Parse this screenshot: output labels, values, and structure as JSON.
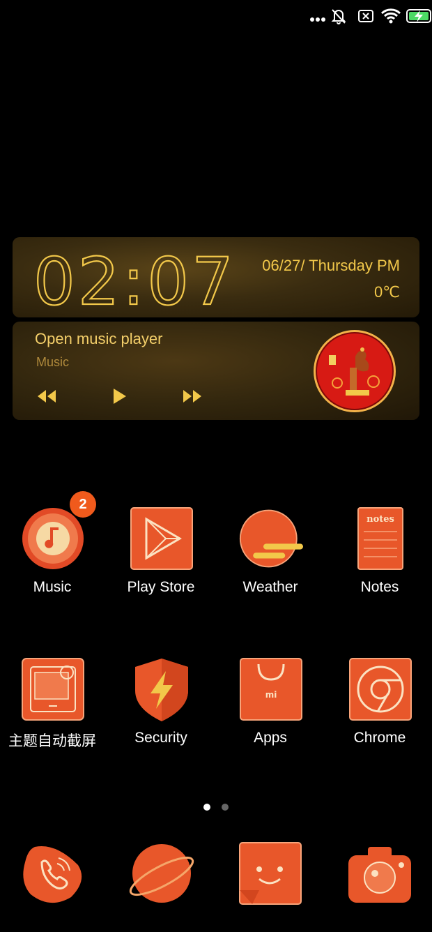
{
  "status_bar": {
    "icons": [
      "more-dots-icon",
      "alarm-off-icon",
      "no-sim-icon",
      "wifi-icon",
      "battery-charging-icon"
    ]
  },
  "clock_widget": {
    "time": "02:07",
    "date": "06/27/ Thursday PM",
    "temperature": "0℃"
  },
  "music_widget": {
    "title": "Open music player",
    "subtitle": "Music",
    "controls": [
      "previous-icon",
      "play-icon",
      "next-icon"
    ]
  },
  "apps_row1": [
    {
      "label": "Music",
      "icon": "music-note-icon",
      "badge": "2"
    },
    {
      "label": "Play Store",
      "icon": "play-store-icon"
    },
    {
      "label": "Weather",
      "icon": "weather-sun-icon"
    },
    {
      "label": "Notes",
      "icon": "notes-icon",
      "icon_text": "notes"
    }
  ],
  "apps_row2": [
    {
      "label": "主题自动截屏",
      "icon": "screenshot-theme-icon"
    },
    {
      "label": "Security",
      "icon": "security-shield-icon"
    },
    {
      "label": "Apps",
      "icon": "mi-apps-bag-icon",
      "icon_text": "mi"
    },
    {
      "label": "Chrome",
      "icon": "chrome-icon"
    }
  ],
  "page_indicator": {
    "pages": 2,
    "current": 1
  },
  "dock": [
    "phone-icon",
    "browser-planet-icon",
    "messages-icon",
    "camera-icon"
  ],
  "colors": {
    "accent": "#e8572a",
    "gold": "#f2c84a",
    "background": "#000000"
  }
}
